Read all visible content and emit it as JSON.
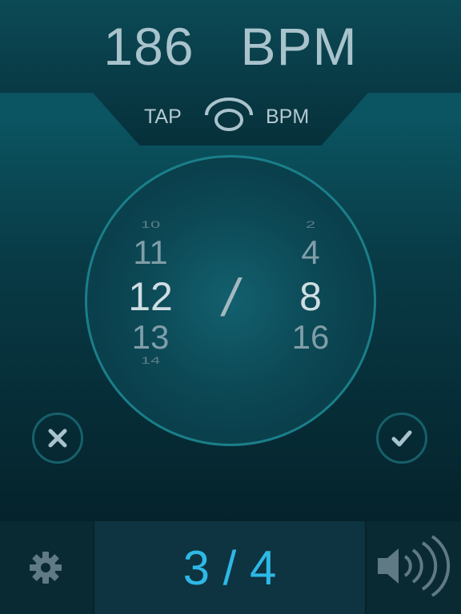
{
  "header": {
    "bpm_value": "186",
    "bpm_unit": "BPM"
  },
  "tap": {
    "left_label": "TAP",
    "right_label": "BPM",
    "icon": "tap-icon"
  },
  "picker": {
    "numerator": {
      "above_far": "10",
      "above": "11",
      "selected": "12",
      "below": "13",
      "below_far": "14"
    },
    "separator": "/",
    "denominator": {
      "above_far": "2",
      "above": "4",
      "selected": "8",
      "below": "16"
    }
  },
  "actions": {
    "cancel_icon": "close-icon",
    "confirm_icon": "check-icon"
  },
  "footer": {
    "time_signature": "3 / 4",
    "settings_icon": "gear-icon",
    "sound_icon": "speaker-icon"
  },
  "colors": {
    "accent": "#2eb8e6",
    "ring": "#1a7f8a",
    "text": "#a9c3cc"
  }
}
